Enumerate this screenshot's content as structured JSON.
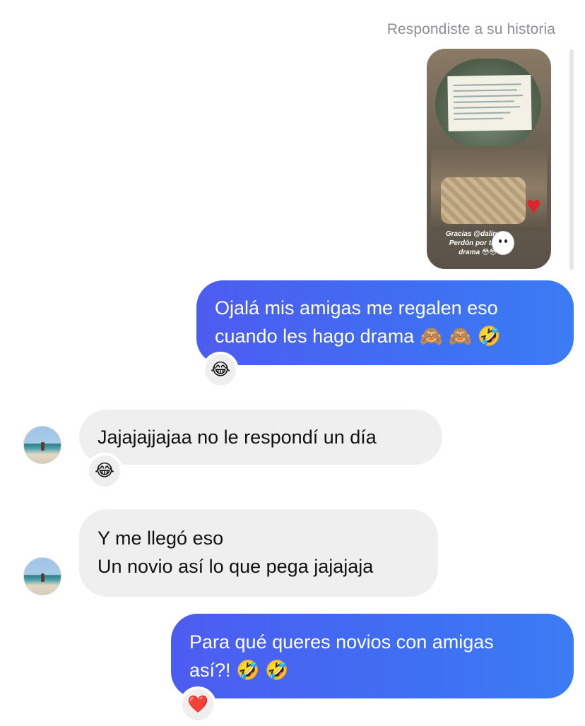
{
  "header": {
    "story_reply_label": "Respondiste a su historia"
  },
  "story": {
    "caption_line1": "Gracias @dalinego",
    "caption_line2": "Perdón por tanto",
    "caption_line3": "drama 😳😳"
  },
  "messages": [
    {
      "direction": "outgoing",
      "lines": [
        "Ojalá mis amigas me regalen eso",
        "cuando les hago drama 🙈 🙈 🤣"
      ],
      "reaction": "😂"
    },
    {
      "direction": "incoming",
      "lines": [
        "Jajajajjajaa no le respondí un día"
      ],
      "reaction": "😂"
    },
    {
      "direction": "incoming",
      "lines": [
        "Y me llegó eso",
        "Un novio así lo que pega jajajaja"
      ]
    },
    {
      "direction": "outgoing",
      "lines": [
        "Para qué queres novios con amigas",
        "así?! 🤣 🤣"
      ],
      "reaction": "❤️"
    }
  ],
  "icons": {
    "heart-sticker": "♥"
  },
  "colors": {
    "outgoing_bubble_start": "#4d5cf0",
    "outgoing_bubble_end": "#3b7cf4",
    "incoming_bubble": "#efeff0",
    "meta_text": "#8e8e93"
  }
}
